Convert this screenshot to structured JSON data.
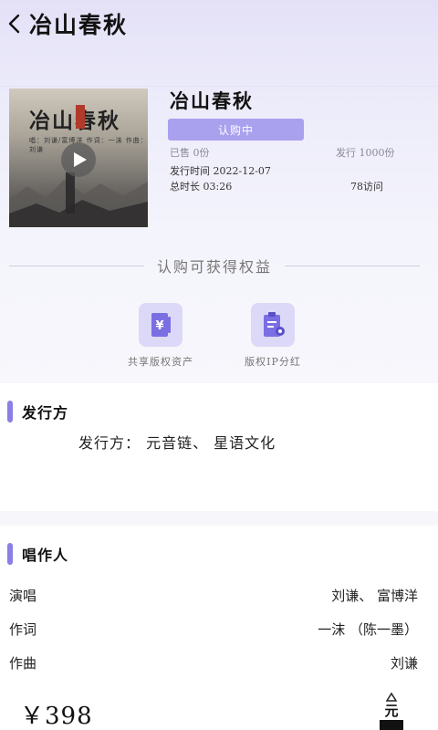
{
  "header": {
    "back_icon": "chevron-left-icon",
    "title": "冶山春秋"
  },
  "cover": {
    "title": "冶山春秋",
    "subtitle": "唱：刘谦/富博洋  作词：一沫  作曲：刘谦",
    "play_icon": "play-icon"
  },
  "song": {
    "title": "冶山春秋",
    "status": "认购中",
    "sold": "已售 0份",
    "issued": "发行 1000份",
    "release_time": "发行时间 2022-12-07",
    "duration": "总时长 03:26",
    "visits": "78访问"
  },
  "benefits": {
    "title": "认购可获得权益",
    "items": [
      {
        "label": "共享版权资产",
        "icon": "yen-book-icon"
      },
      {
        "label": "版权IP分红",
        "icon": "clipboard-share-icon"
      }
    ]
  },
  "issuer": {
    "section_title": "发行方",
    "text": "发行方：   元音链、 星语文化"
  },
  "creators": {
    "section_title": "唱作人",
    "rows": [
      {
        "label": "演唱",
        "value": "刘谦、 富博洋"
      },
      {
        "label": "作词",
        "value": "一沫 （陈一墨）"
      },
      {
        "label": "作曲",
        "value": "刘谦"
      }
    ]
  },
  "footer": {
    "price": "￥398",
    "logo_text": "元音链"
  },
  "colors": {
    "accent": "#8a7fe6",
    "status_button": "#a9a0ee",
    "icon_bg": "#dcd8f7"
  }
}
